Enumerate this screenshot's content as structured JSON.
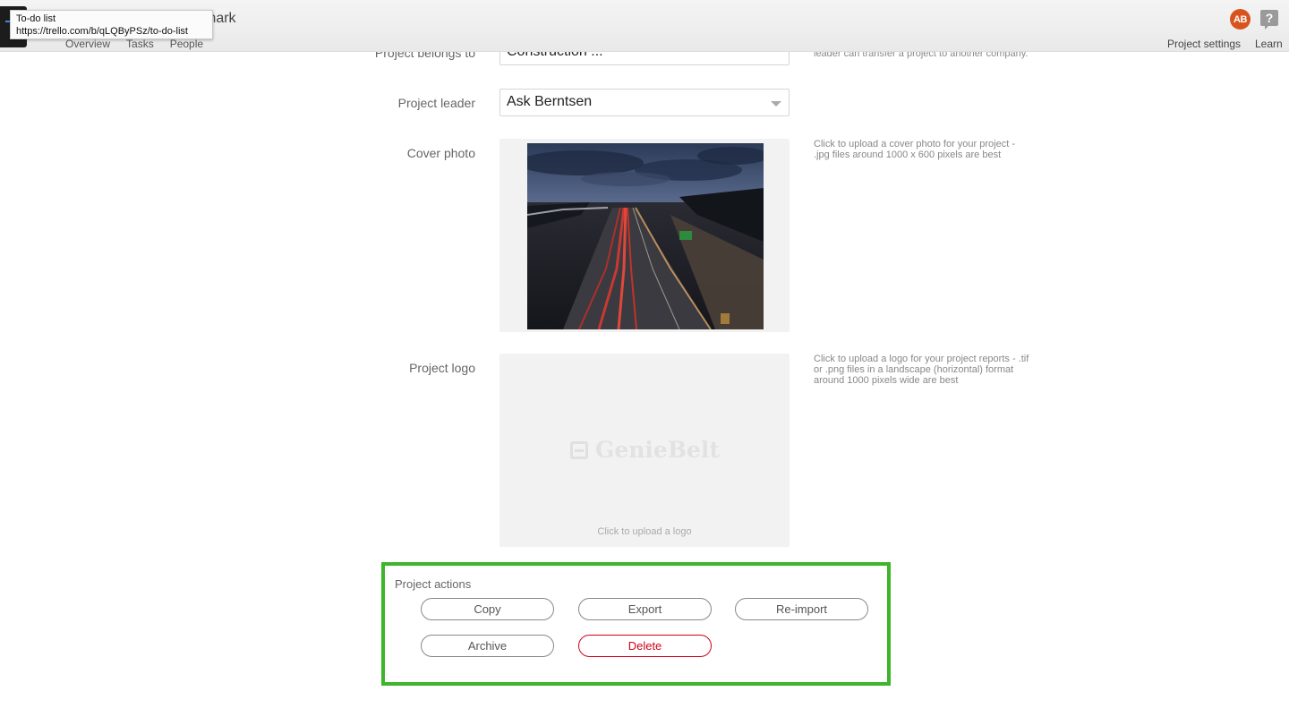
{
  "tooltip": {
    "title": "To-do list",
    "url": "https://trello.com/b/qLQByPSz/to-do-list"
  },
  "header": {
    "project_title_fragment": "mark",
    "tabs": [
      "Overview",
      "Tasks",
      "People"
    ],
    "avatar_initials": "AB",
    "project_settings": "Project settings",
    "learn": "Learn"
  },
  "form": {
    "belongs_to": {
      "label": "Project belongs to",
      "value": "Construction ...",
      "hint": "leader can transfer a project to another company."
    },
    "leader": {
      "label": "Project leader",
      "value": "Ask Berntsen"
    },
    "cover": {
      "label": "Cover photo",
      "hint": "Click to upload a cover photo for your project - .jpg files around 1000 x 600 pixels are best"
    },
    "logo": {
      "label": "Project logo",
      "hint": "Click to upload a logo for your project reports - .tif or .png files in a landscape (horizontal) format around 1000 pixels wide are best",
      "placeholder_brand": "GenieBelt",
      "caption": "Click to upload a logo"
    }
  },
  "actions": {
    "title": "Project actions",
    "copy": "Copy",
    "export": "Export",
    "reimport": "Re-import",
    "archive": "Archive",
    "delete": "Delete"
  },
  "colors": {
    "avatar": "#d9531e",
    "highlight_border": "#3db52a",
    "danger": "#d0021b"
  }
}
